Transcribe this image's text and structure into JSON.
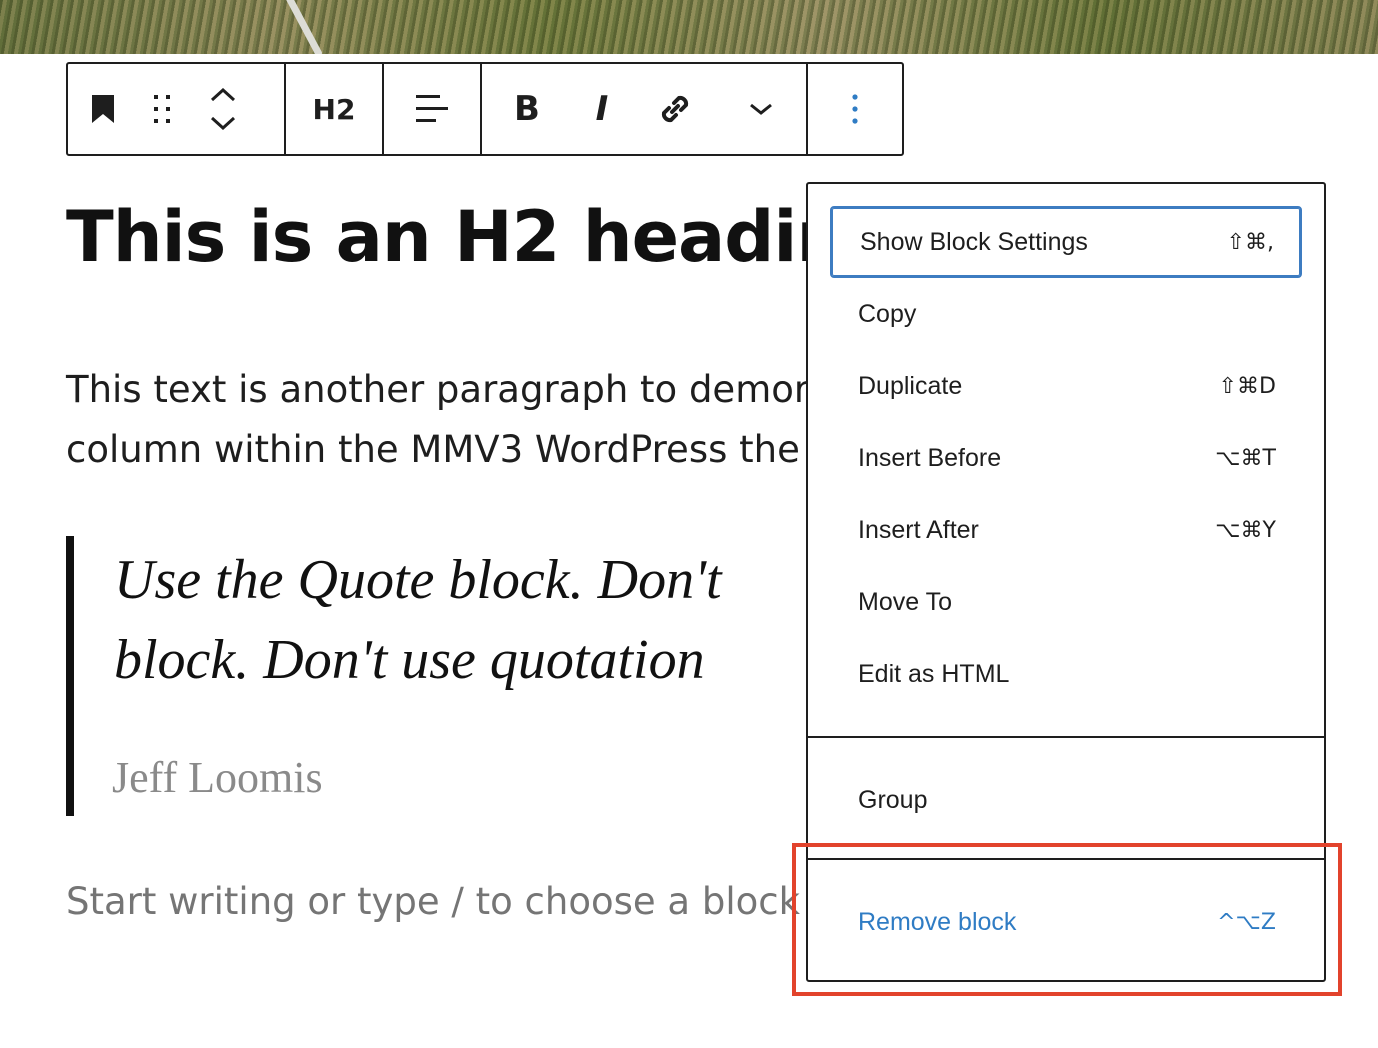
{
  "toolbar": {
    "heading_level": "H2",
    "icons": [
      "bookmark-icon",
      "drag-handle-icon",
      "move-up-icon",
      "move-down-icon",
      "align-icon",
      "bold-icon",
      "italic-icon",
      "link-icon",
      "chevron-down-icon",
      "more-options-icon"
    ],
    "bold_label": "B",
    "italic_label": "I"
  },
  "content": {
    "heading": "This is an H2 headir",
    "paragraph_lines": [
      "This text is another paragraph to demor",
      "column within the MMV3 WordPress the"
    ],
    "quote_lines": [
      "Use the Quote block. Don't",
      "block. Don't use quotation"
    ],
    "citation": "Jeff Loomis",
    "placeholder": "Start writing or type / to choose a block"
  },
  "menu": {
    "items": [
      {
        "label": "Show Block Settings",
        "shortcut": "⇧⌘,"
      },
      {
        "label": "Copy",
        "shortcut": ""
      },
      {
        "label": "Duplicate",
        "shortcut": "⇧⌘D"
      },
      {
        "label": "Insert Before",
        "shortcut": "⌥⌘T"
      },
      {
        "label": "Insert After",
        "shortcut": "⌥⌘Y"
      },
      {
        "label": "Move To",
        "shortcut": ""
      },
      {
        "label": "Edit as HTML",
        "shortcut": ""
      }
    ],
    "group_label": "Group",
    "remove": {
      "label": "Remove block",
      "shortcut": "^⌥Z"
    }
  },
  "colors": {
    "accent": "#3d7cc1",
    "danger_text": "#2f7cc4",
    "highlight": "#e2432c"
  }
}
